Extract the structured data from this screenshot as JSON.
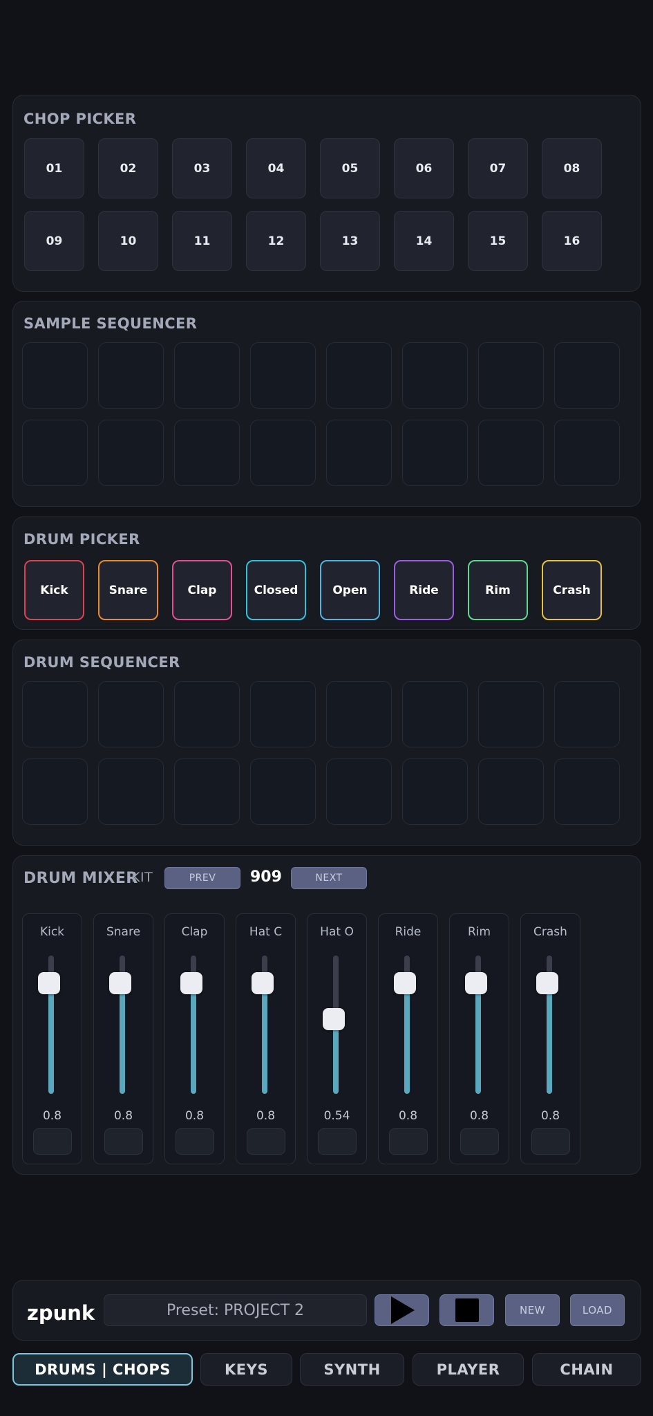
{
  "chop_picker": {
    "title": "CHOP PICKER",
    "chops": [
      "01",
      "02",
      "03",
      "04",
      "05",
      "06",
      "07",
      "08",
      "09",
      "10",
      "11",
      "12",
      "13",
      "14",
      "15",
      "16"
    ]
  },
  "sample_sequencer": {
    "title": "SAMPLE SEQUENCER",
    "steps": 16
  },
  "drum_picker": {
    "title": "DRUM PICKER",
    "drums": [
      {
        "label": "Kick",
        "color": "#e0414f"
      },
      {
        "label": "Snare",
        "color": "#e88a2e"
      },
      {
        "label": "Clap",
        "color": "#e64f93"
      },
      {
        "label": "Closed",
        "color": "#2fc4d8"
      },
      {
        "label": "Open",
        "color": "#4fb4e0"
      },
      {
        "label": "Ride",
        "color": "#9b5ee0"
      },
      {
        "label": "Rim",
        "color": "#5ed88f"
      },
      {
        "label": "Crash",
        "color": "#e8c23a"
      }
    ]
  },
  "drum_sequencer": {
    "title": "DRUM SEQUENCER",
    "steps": 16
  },
  "drum_mixer": {
    "title": "DRUM MIXER",
    "kit_label": "KIT",
    "prev_label": "PREV",
    "kit_name": "909",
    "next_label": "NEXT",
    "channels": [
      {
        "label": "Kick",
        "value": "0.8",
        "level": 0.8
      },
      {
        "label": "Snare",
        "value": "0.8",
        "level": 0.8
      },
      {
        "label": "Clap",
        "value": "0.8",
        "level": 0.8
      },
      {
        "label": "Hat C",
        "value": "0.8",
        "level": 0.8
      },
      {
        "label": "Hat O",
        "value": "0.54",
        "level": 0.54
      },
      {
        "label": "Ride",
        "value": "0.8",
        "level": 0.8
      },
      {
        "label": "Rim",
        "value": "0.8",
        "level": 0.8
      },
      {
        "label": "Crash",
        "value": "0.8",
        "level": 0.8
      }
    ]
  },
  "bottom_bar": {
    "logo": "zpunk",
    "preset": "Preset: PROJECT 2",
    "play_icon": "play-icon",
    "stop_icon": "stop-icon",
    "new_label": "NEW",
    "load_label": "LOAD"
  },
  "tabs": [
    {
      "label": "DRUMS | CHOPS",
      "active": true
    },
    {
      "label": "KEYS",
      "active": false
    },
    {
      "label": "SYNTH",
      "active": false
    },
    {
      "label": "PLAYER",
      "active": false
    },
    {
      "label": "CHAIN",
      "active": false
    }
  ]
}
